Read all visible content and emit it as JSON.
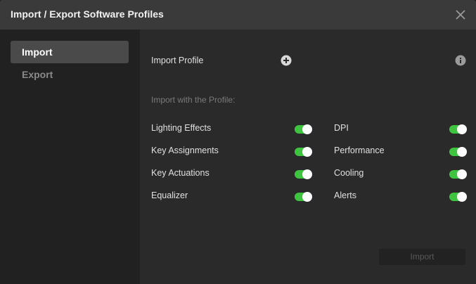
{
  "window": {
    "title": "Import / Export Software Profiles"
  },
  "sidebar": {
    "items": [
      {
        "label": "Import",
        "active": true
      },
      {
        "label": "Export",
        "active": false
      }
    ]
  },
  "import": {
    "profile_label": "Import Profile",
    "section_title": "Import with the Profile:",
    "options_left": [
      {
        "label": "Lighting Effects",
        "enabled": true
      },
      {
        "label": "Key Assignments",
        "enabled": true
      },
      {
        "label": "Key Actuations",
        "enabled": true
      },
      {
        "label": "Equalizer",
        "enabled": true
      }
    ],
    "options_right": [
      {
        "label": "DPI",
        "enabled": true
      },
      {
        "label": "Performance",
        "enabled": true
      },
      {
        "label": "Cooling",
        "enabled": true
      },
      {
        "label": "Alerts",
        "enabled": true
      }
    ],
    "button_label": "Import"
  },
  "icons": {
    "close": "close-icon",
    "add": "plus-circle-icon",
    "info": "info-icon"
  },
  "colors": {
    "toggle_on": "#3fc43f",
    "titlebar": "#3a3a3a",
    "sidebar_active": "#4a4a4a"
  }
}
